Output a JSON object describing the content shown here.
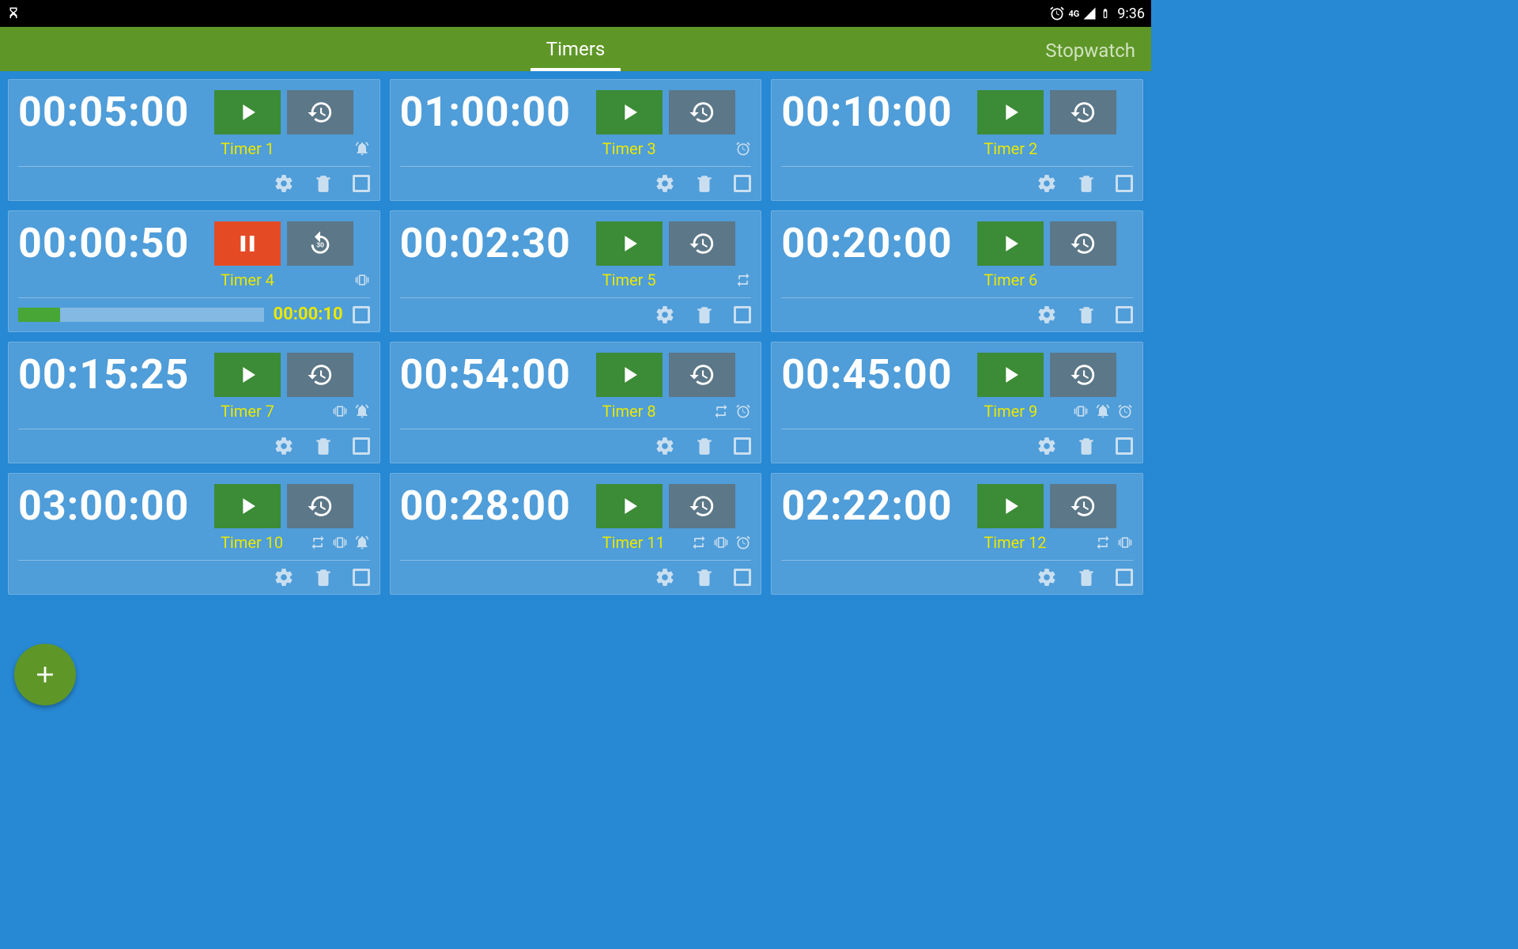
{
  "statusbar": {
    "clock": "9:36",
    "network": "4G"
  },
  "tabs": {
    "active": "Timers",
    "inactive": "Stopwatch"
  },
  "timers": [
    {
      "time": "00:05:00",
      "name": "Timer 1",
      "running": false,
      "indicators": [
        "bell"
      ]
    },
    {
      "time": "01:00:00",
      "name": "Timer 3",
      "running": false,
      "indicators": [
        "alarm"
      ]
    },
    {
      "time": "00:10:00",
      "name": "Timer 2",
      "running": false,
      "indicators": []
    },
    {
      "time": "00:00:50",
      "name": "Timer 4",
      "running": true,
      "indicators": [
        "vibrate"
      ],
      "elapsed": "00:00:10",
      "progress_pct": 17
    },
    {
      "time": "00:02:30",
      "name": "Timer 5",
      "running": false,
      "indicators": [
        "repeat"
      ]
    },
    {
      "time": "00:20:00",
      "name": "Timer 6",
      "running": false,
      "indicators": []
    },
    {
      "time": "00:15:25",
      "name": "Timer 7",
      "running": false,
      "indicators": [
        "vibrate",
        "bell"
      ]
    },
    {
      "time": "00:54:00",
      "name": "Timer 8",
      "running": false,
      "indicators": [
        "repeat",
        "alarm"
      ]
    },
    {
      "time": "00:45:00",
      "name": "Timer 9",
      "running": false,
      "indicators": [
        "vibrate",
        "bell",
        "alarm"
      ]
    },
    {
      "time": "03:00:00",
      "name": "Timer 10",
      "running": false,
      "indicators": [
        "repeat",
        "vibrate",
        "bell"
      ]
    },
    {
      "time": "00:28:00",
      "name": "Timer 11",
      "running": false,
      "indicators": [
        "repeat",
        "vibrate",
        "alarm"
      ]
    },
    {
      "time": "02:22:00",
      "name": "Timer 12",
      "running": false,
      "indicators": [
        "repeat",
        "vibrate"
      ]
    }
  ],
  "icons": {
    "play": "play",
    "pause": "pause",
    "reset": "history",
    "rewind30": "replay30",
    "settings": "gear",
    "delete": "trash",
    "add": "plus"
  }
}
